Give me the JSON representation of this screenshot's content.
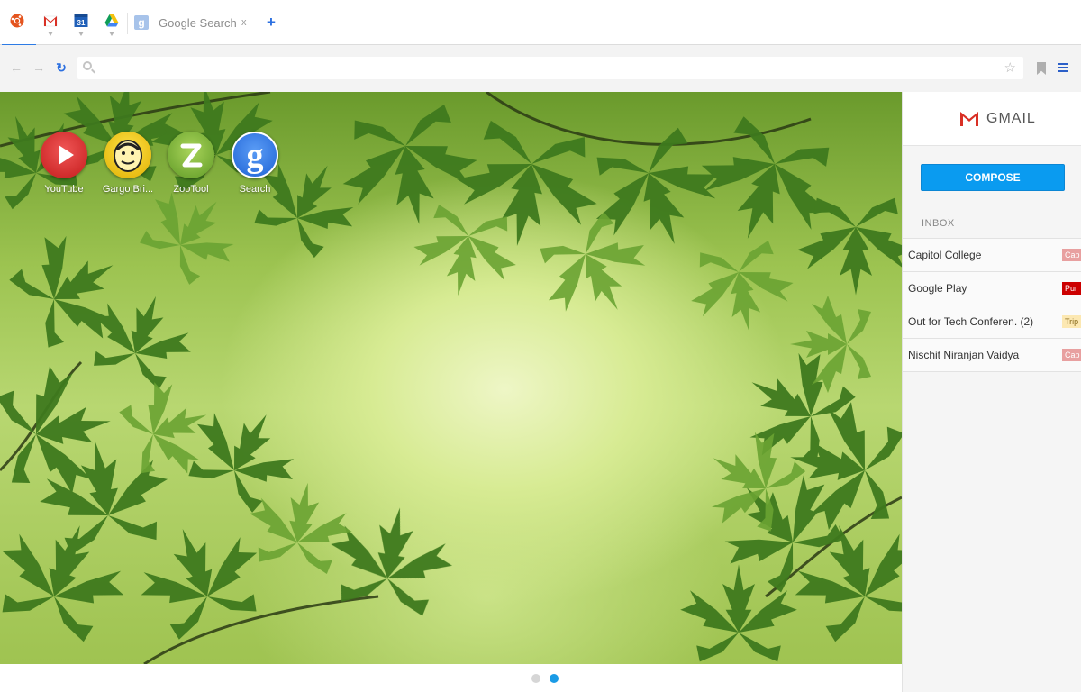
{
  "tabs": {
    "pinned": [
      {
        "name": "chrome-favicon",
        "icon": "ubuntu-chrome-icon"
      },
      {
        "name": "gmail-favicon",
        "icon": "gmail-icon"
      },
      {
        "name": "calendar-favicon",
        "icon": "calendar-icon",
        "text": "31"
      },
      {
        "name": "drive-favicon",
        "icon": "drive-icon"
      }
    ],
    "active_tab": {
      "favicon_text": "g",
      "title": "Google Search",
      "close": "x"
    },
    "new_tab": "+"
  },
  "toolbar": {
    "back": "←",
    "forward": "→",
    "reload": "↻",
    "omnibox_value": "",
    "star": "☆"
  },
  "apps": [
    {
      "label": "YouTube",
      "icon": "youtube-icon"
    },
    {
      "label": "Gargo Bri...",
      "icon": "gargo-icon"
    },
    {
      "label": "ZooTool",
      "icon": "zootool-icon"
    },
    {
      "label": "Search",
      "icon": "google-search-icon",
      "glyph": "g"
    }
  ],
  "pager": {
    "pages": 2,
    "active_page": 2
  },
  "gmail": {
    "title": "GMAIL",
    "compose_label": "COMPOSE",
    "inbox_label": "INBOX",
    "messages": [
      {
        "from": "Capitol College",
        "tag": "Cap",
        "tag_color": "#e8a0a0",
        "tag_text_color": "#ffffff"
      },
      {
        "from": "Google Play",
        "tag": "Pur",
        "tag_color": "#cc0000",
        "tag_text_color": "#ffffff"
      },
      {
        "from": "Out for Tech Conferen. (2)",
        "tag": "Trip",
        "tag_color": "#fce8b2",
        "tag_text_color": "#8a6d20"
      },
      {
        "from": "Nischit Niranjan Vaidya",
        "tag": "Cap",
        "tag_color": "#e8a0a0",
        "tag_text_color": "#ffffff"
      }
    ]
  },
  "colors": {
    "accent": "#0a9bf0",
    "link_blue": "#2b6fe0"
  }
}
